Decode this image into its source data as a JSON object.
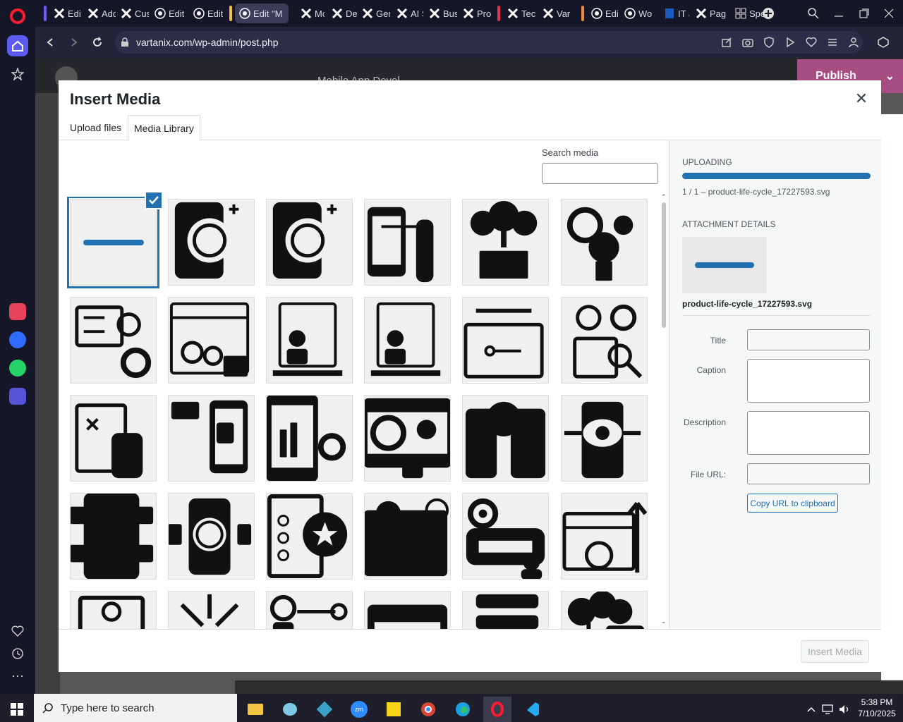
{
  "browser": {
    "tabs": [
      {
        "title": "Edi",
        "icon": "elementor-x-icon"
      },
      {
        "title": "Add",
        "icon": "elementor-x-icon"
      },
      {
        "title": "Cus",
        "icon": "elementor-x-icon"
      },
      {
        "title": "Edit",
        "icon": "wordpress-icon"
      },
      {
        "title": "Edit",
        "icon": "wordpress-icon"
      },
      {
        "title": "Edit \"M",
        "icon": "wordpress-icon"
      },
      {
        "title": "Mo",
        "icon": "elementor-x-icon"
      },
      {
        "title": "Dev",
        "icon": "elementor-x-icon"
      },
      {
        "title": "Ger",
        "icon": "elementor-x-icon"
      },
      {
        "title": "AI S",
        "icon": "elementor-x-icon"
      },
      {
        "title": "Bus",
        "icon": "elementor-x-icon"
      },
      {
        "title": "Pro",
        "icon": "elementor-x-icon"
      },
      {
        "title": "Tec",
        "icon": "elementor-x-icon"
      },
      {
        "title": "Var",
        "icon": "elementor-x-icon"
      },
      {
        "title": "Edi",
        "icon": "wordpress-icon"
      },
      {
        "title": "Wo",
        "icon": "wordpress-icon"
      },
      {
        "title": "IT a",
        "icon": "doc-icon"
      },
      {
        "title": "Pag",
        "icon": "elementor-x-icon"
      },
      {
        "title": "Spe",
        "icon": "grid-icon"
      }
    ],
    "url": "vartanix.com/wp-admin/post.php"
  },
  "editor": {
    "document_title": "Mobile App Devel...",
    "publish_label": "Publish"
  },
  "modal": {
    "title": "Insert Media",
    "tabs": [
      "Upload files",
      "Media Library"
    ],
    "active_tab": "Media Library",
    "search_label": "Search media",
    "search_value": "",
    "uploading": {
      "heading": "UPLOADING",
      "progress_percent": 100,
      "status": "1 / 1  –  product-life-cycle_17227593.svg"
    },
    "attachment": {
      "heading": "ATTACHMENT DETAILS",
      "filename": "product-life-cycle_17227593.svg",
      "fields": {
        "title_label": "Title",
        "caption_label": "Caption",
        "description_label": "Description",
        "file_url_label": "File URL:"
      },
      "copy_url_label": "Copy URL to clipboard"
    },
    "media_items": [
      "product-life-cycle",
      "ai-brain-phone",
      "ai-brain-phone",
      "app-touch-diamond",
      "cloud-rocket-launch",
      "gear-team-award",
      "checklist-monitor-gear",
      "dashboard-settings",
      "profile-rating",
      "profile-rating",
      "usb-connect",
      "idea-box-search",
      "strategy-chess",
      "mobile-shopping",
      "phone-growth-chart",
      "support-engineer",
      "phone-sync",
      "phone-eye",
      "network-user",
      "phone-circuit",
      "checklist-star",
      "idea-chat",
      "gear-workflow-user",
      "web-settings-growth",
      "vision-security",
      "focus-arrows",
      "robot-process",
      "web-browser",
      "server-stack",
      "cloud-chart"
    ],
    "insert_label": "Insert Media"
  },
  "taskbar": {
    "search_placeholder": "Type here to search",
    "time": "5:38 PM",
    "date": "7/10/2025"
  }
}
